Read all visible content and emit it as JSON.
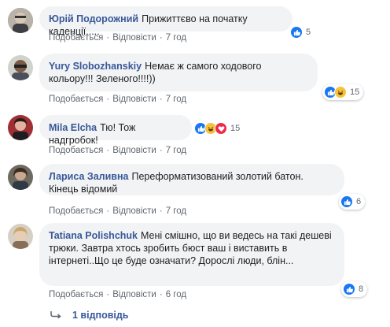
{
  "actions": {
    "like": "Подобається",
    "reply": "Відповісти",
    "separator": "·"
  },
  "colors": {
    "author": "#385898",
    "bubble": "#f2f3f5",
    "meta": "#606770",
    "like": "#1877f2",
    "haha": "#f7c23b",
    "love": "#f0284a"
  },
  "comments": [
    {
      "author": "Юрій Подорожний",
      "text": "Прижиттєво на початку каденції.....",
      "time": "7 год",
      "reactions": {
        "icons": [
          "like-icon"
        ],
        "count": "5"
      }
    },
    {
      "author": "Yury Slobozhanskiy",
      "text": "Немає ж самого ходового кольору!!! Зеленого!!!!))",
      "time": "7 год",
      "reactions": {
        "icons": [
          "like-icon",
          "haha-icon"
        ],
        "count": "15"
      }
    },
    {
      "author": "Mila Elcha",
      "text": "Тю! Тож надгробок!",
      "time": "7 год",
      "reactions": {
        "icons": [
          "like-icon",
          "haha-icon",
          "love-icon"
        ],
        "count": "15"
      }
    },
    {
      "author": "Лариса Заливна",
      "text": "Переформатизований золотий батон. Кінець відомий",
      "time": "7 год",
      "reactions": {
        "icons": [
          "like-icon"
        ],
        "count": "6"
      }
    },
    {
      "author": "Tatiana Polishchuk",
      "text": "Мені смішно, що ви ведесь на такі дешеві трюки. Завтра хтось зробить бюст ваш і виставить в інтернеті..Що це буде означати? Дорослі люди, блін...",
      "time": "6 год",
      "reactions": {
        "icons": [
          "like-icon"
        ],
        "count": "8"
      }
    }
  ],
  "replies": {
    "label": "1 відповідь",
    "icon": "reply-arrow-icon"
  }
}
